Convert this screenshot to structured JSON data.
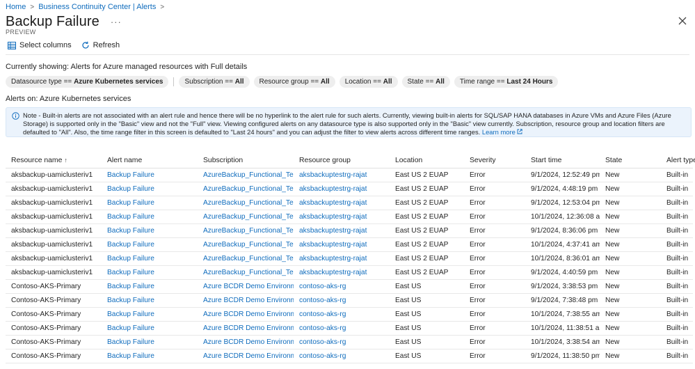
{
  "breadcrumb": {
    "home": "Home",
    "parent": "Business Continuity Center | Alerts"
  },
  "header": {
    "title": "Backup Failure",
    "more": "···",
    "subtitle": "PREVIEW"
  },
  "toolbar": {
    "select_columns": "Select columns",
    "refresh": "Refresh"
  },
  "showing": "Currently showing: Alerts for Azure managed resources with Full details",
  "filters": [
    {
      "key": "Datasource type == ",
      "value": "Azure Kubernetes services"
    },
    {
      "key": "Subscription == ",
      "value": "All"
    },
    {
      "key": "Resource group == ",
      "value": "All"
    },
    {
      "key": "Location == ",
      "value": "All"
    },
    {
      "key": "State == ",
      "value": "All"
    },
    {
      "key": "Time range == ",
      "value": "Last 24 Hours"
    }
  ],
  "alerts_on": "Alerts on: Azure Kubernetes services",
  "note": {
    "text": "Note - Built-in alerts are not associated with an alert rule and hence there will be no hyperlink to the alert rule for such alerts. Currently, viewing built-in alerts for SQL/SAP HANA databases in Azure VMs and Azure Files (Azure Storage) is supported only in the \"Basic\" view and not the \"Full\" view. Viewing configured alerts on any datasource type is also supported only in the \"Basic\" view currently. Subscription, resource group and location filters are defaulted to \"All\". Also, the time range filter in this screen is defaulted to \"Last 24 hours\" and you can adjust the filter to view alerts across different time ranges.",
    "learn_more": "Learn more"
  },
  "table": {
    "columns": [
      "Resource name",
      "Alert name",
      "Subscription",
      "Resource group",
      "Location",
      "Severity",
      "Start time",
      "State",
      "Alert type"
    ],
    "sort_arrow": "↑",
    "rows": [
      [
        "aksbackup-uamiclusteriv1",
        "Backup Failure",
        "AzureBackup_Functional_Testing",
        "aksbackuptestrg-rajat",
        "East US 2 EUAP",
        "Error",
        "9/1/2024, 12:52:49 pm",
        "New",
        "Built-in"
      ],
      [
        "aksbackup-uamiclusteriv1",
        "Backup Failure",
        "AzureBackup_Functional_Testing",
        "aksbackuptestrg-rajat",
        "East US 2 EUAP",
        "Error",
        "9/1/2024, 4:48:19 pm",
        "New",
        "Built-in"
      ],
      [
        "aksbackup-uamiclusteriv1",
        "Backup Failure",
        "AzureBackup_Functional_Testing",
        "aksbackuptestrg-rajat",
        "East US 2 EUAP",
        "Error",
        "9/1/2024, 12:53:04 pm",
        "New",
        "Built-in"
      ],
      [
        "aksbackup-uamiclusteriv1",
        "Backup Failure",
        "AzureBackup_Functional_Testing",
        "aksbackuptestrg-rajat",
        "East US 2 EUAP",
        "Error",
        "10/1/2024, 12:36:08 am",
        "New",
        "Built-in"
      ],
      [
        "aksbackup-uamiclusteriv1",
        "Backup Failure",
        "AzureBackup_Functional_Testing",
        "aksbackuptestrg-rajat",
        "East US 2 EUAP",
        "Error",
        "9/1/2024, 8:36:06 pm",
        "New",
        "Built-in"
      ],
      [
        "aksbackup-uamiclusteriv1",
        "Backup Failure",
        "AzureBackup_Functional_Testing",
        "aksbackuptestrg-rajat",
        "East US 2 EUAP",
        "Error",
        "10/1/2024, 4:37:41 am",
        "New",
        "Built-in"
      ],
      [
        "aksbackup-uamiclusteriv1",
        "Backup Failure",
        "AzureBackup_Functional_Testing",
        "aksbackuptestrg-rajat",
        "East US 2 EUAP",
        "Error",
        "10/1/2024, 8:36:01 am",
        "New",
        "Built-in"
      ],
      [
        "aksbackup-uamiclusteriv1",
        "Backup Failure",
        "AzureBackup_Functional_Testing",
        "aksbackuptestrg-rajat",
        "East US 2 EUAP",
        "Error",
        "9/1/2024, 4:40:59 pm",
        "New",
        "Built-in"
      ],
      [
        "Contoso-AKS-Primary",
        "Backup Failure",
        "Azure BCDR Demo Environment",
        "contoso-aks-rg",
        "East US",
        "Error",
        "9/1/2024, 3:38:53 pm",
        "New",
        "Built-in"
      ],
      [
        "Contoso-AKS-Primary",
        "Backup Failure",
        "Azure BCDR Demo Environment",
        "contoso-aks-rg",
        "East US",
        "Error",
        "9/1/2024, 7:38:48 pm",
        "New",
        "Built-in"
      ],
      [
        "Contoso-AKS-Primary",
        "Backup Failure",
        "Azure BCDR Demo Environment",
        "contoso-aks-rg",
        "East US",
        "Error",
        "10/1/2024, 7:38:55 am",
        "New",
        "Built-in"
      ],
      [
        "Contoso-AKS-Primary",
        "Backup Failure",
        "Azure BCDR Demo Environment",
        "contoso-aks-rg",
        "East US",
        "Error",
        "10/1/2024, 11:38:51 am",
        "New",
        "Built-in"
      ],
      [
        "Contoso-AKS-Primary",
        "Backup Failure",
        "Azure BCDR Demo Environment",
        "contoso-aks-rg",
        "East US",
        "Error",
        "10/1/2024, 3:38:54 am",
        "New",
        "Built-in"
      ],
      [
        "Contoso-AKS-Primary",
        "Backup Failure",
        "Azure BCDR Demo Environment",
        "contoso-aks-rg",
        "East US",
        "Error",
        "9/1/2024, 11:38:50 pm",
        "New",
        "Built-in"
      ]
    ]
  },
  "colors": {
    "link": "#0f6cbd",
    "note_bg": "#ebf3fc",
    "pill_bg": "#eeeeee"
  },
  "icons": {
    "select_columns": "columns-icon",
    "refresh": "refresh-icon",
    "close": "close-icon",
    "info": "info-icon",
    "learn_more": "external-link-icon"
  }
}
